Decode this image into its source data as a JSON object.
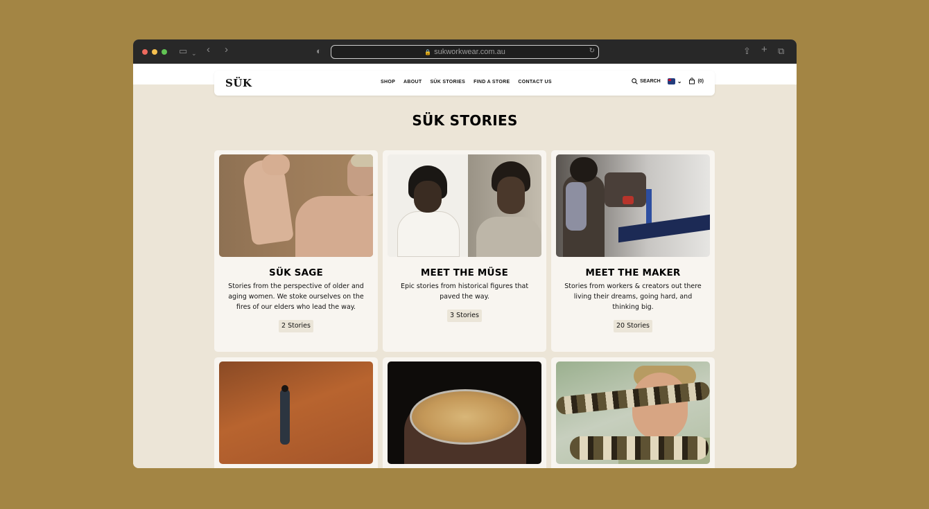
{
  "browser": {
    "url": "sukworkwear.com.au"
  },
  "site": {
    "logo": "SÜK",
    "nav": [
      "SHOP",
      "ABOUT",
      "SÜK STORIES",
      "FIND A STORE",
      "CONTACT US"
    ],
    "search_label": "SEARCH",
    "cart_label": "(0)"
  },
  "page": {
    "title": "SÜK STORIES"
  },
  "cards": [
    {
      "title": "SÜK SAGE",
      "description": "Stories from the perspective of older and aging women. We stoke ourselves on the fires of our elders who lead the way.",
      "count": "2 Stories"
    },
    {
      "title": "MEET THE MÜSE",
      "description": "Epic stories from historical figures that paved the way.",
      "count": "3 Stories"
    },
    {
      "title": "MEET THE MAKER",
      "description": "Stories from workers & creators out there living their dreams, going hard, and thinking big.",
      "count": "20 Stories"
    }
  ],
  "icons": {
    "search": "search-icon",
    "cart": "bag-icon",
    "flag": "australia-flag-icon",
    "chevron": "chevron-down-icon"
  }
}
